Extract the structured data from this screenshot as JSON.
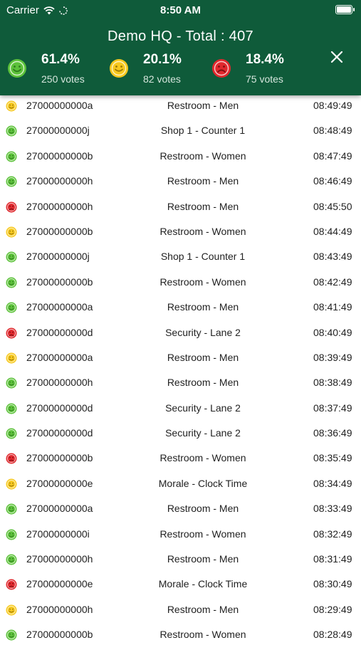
{
  "status_bar": {
    "carrier": "Carrier",
    "time": "8:50 AM"
  },
  "header": {
    "title": "Demo HQ - Total : 407",
    "stats": [
      {
        "percent": "61.4%",
        "votes": "250 votes",
        "face": "green-smiley-icon"
      },
      {
        "percent": "20.1%",
        "votes": "82 votes",
        "face": "yellow-smiley-icon"
      },
      {
        "percent": "18.4%",
        "votes": "75 votes",
        "face": "red-sad-icon"
      }
    ],
    "close_icon": "close-icon"
  },
  "colors": {
    "header_bg": "#0f5b3a",
    "green": "#5cc13a",
    "yellow": "#f6c81e",
    "red": "#e0282d"
  },
  "rows": [
    {
      "face": "yellow",
      "id": "27000000000a",
      "location": "Restroom - Men",
      "time": "08:49:49"
    },
    {
      "face": "green",
      "id": "27000000000j",
      "location": "Shop 1 - Counter 1",
      "time": "08:48:49"
    },
    {
      "face": "green",
      "id": "27000000000b",
      "location": "Restroom - Women",
      "time": "08:47:49"
    },
    {
      "face": "green",
      "id": "27000000000h",
      "location": "Restroom - Men",
      "time": "08:46:49"
    },
    {
      "face": "red",
      "id": "27000000000h",
      "location": "Restroom - Men",
      "time": "08:45:50"
    },
    {
      "face": "yellow",
      "id": "27000000000b",
      "location": "Restroom - Women",
      "time": "08:44:49"
    },
    {
      "face": "green",
      "id": "27000000000j",
      "location": "Shop 1 - Counter 1",
      "time": "08:43:49"
    },
    {
      "face": "green",
      "id": "27000000000b",
      "location": "Restroom - Women",
      "time": "08:42:49"
    },
    {
      "face": "green",
      "id": "27000000000a",
      "location": "Restroom - Men",
      "time": "08:41:49"
    },
    {
      "face": "red",
      "id": "27000000000d",
      "location": "Security - Lane 2",
      "time": "08:40:49"
    },
    {
      "face": "yellow",
      "id": "27000000000a",
      "location": "Restroom - Men",
      "time": "08:39:49"
    },
    {
      "face": "green",
      "id": "27000000000h",
      "location": "Restroom - Men",
      "time": "08:38:49"
    },
    {
      "face": "green",
      "id": "27000000000d",
      "location": "Security - Lane 2",
      "time": "08:37:49"
    },
    {
      "face": "green",
      "id": "27000000000d",
      "location": "Security - Lane 2",
      "time": "08:36:49"
    },
    {
      "face": "red",
      "id": "27000000000b",
      "location": "Restroom - Women",
      "time": "08:35:49"
    },
    {
      "face": "yellow",
      "id": "27000000000e",
      "location": "Morale - Clock Time",
      "time": "08:34:49"
    },
    {
      "face": "green",
      "id": "27000000000a",
      "location": "Restroom - Men",
      "time": "08:33:49"
    },
    {
      "face": "green",
      "id": "27000000000i",
      "location": "Restroom - Women",
      "time": "08:32:49"
    },
    {
      "face": "green",
      "id": "27000000000h",
      "location": "Restroom - Men",
      "time": "08:31:49"
    },
    {
      "face": "red",
      "id": "27000000000e",
      "location": "Morale - Clock Time",
      "time": "08:30:49"
    },
    {
      "face": "yellow",
      "id": "27000000000h",
      "location": "Restroom - Men",
      "time": "08:29:49"
    },
    {
      "face": "green",
      "id": "27000000000b",
      "location": "Restroom - Women",
      "time": "08:28:49"
    }
  ]
}
